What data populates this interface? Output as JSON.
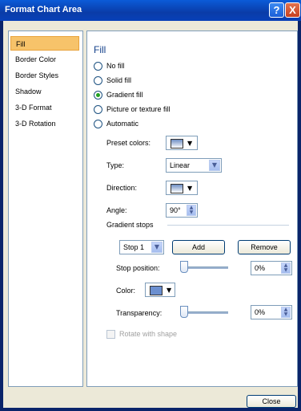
{
  "window": {
    "title": "Format Chart Area",
    "help_label": "?",
    "close_label": "X"
  },
  "sidebar": {
    "items": [
      {
        "label": "Fill"
      },
      {
        "label": "Border Color"
      },
      {
        "label": "Border Styles"
      },
      {
        "label": "Shadow"
      },
      {
        "label": "3-D Format"
      },
      {
        "label": "3-D Rotation"
      }
    ]
  },
  "fill": {
    "heading": "Fill",
    "options": [
      {
        "label": "No fill",
        "checked": false
      },
      {
        "label": "Solid fill",
        "checked": false
      },
      {
        "label": "Gradient fill",
        "checked": true
      },
      {
        "label": "Picture or texture fill",
        "checked": false
      },
      {
        "label": "Automatic",
        "checked": false
      }
    ],
    "preset_colors_label": "Preset colors:",
    "type_label": "Type:",
    "type_value": "Linear",
    "direction_label": "Direction:",
    "angle_label": "Angle:",
    "angle_value": "90°",
    "gradient_stops_label": "Gradient stops",
    "stop_select_value": "Stop 1",
    "add_label": "Add",
    "remove_label": "Remove",
    "stop_position_label": "Stop position:",
    "stop_position_value": "0%",
    "stop_position_level": 0,
    "color_label": "Color:",
    "transparency_label": "Transparency:",
    "transparency_value": "0%",
    "transparency_level": 0,
    "rotate_label": "Rotate with shape"
  },
  "footer": {
    "close_label": "Close"
  },
  "icon_names": [
    "help-icon",
    "close-icon",
    "dropdown-arrow-icon",
    "spin-icon",
    "paint-bucket-icon"
  ]
}
